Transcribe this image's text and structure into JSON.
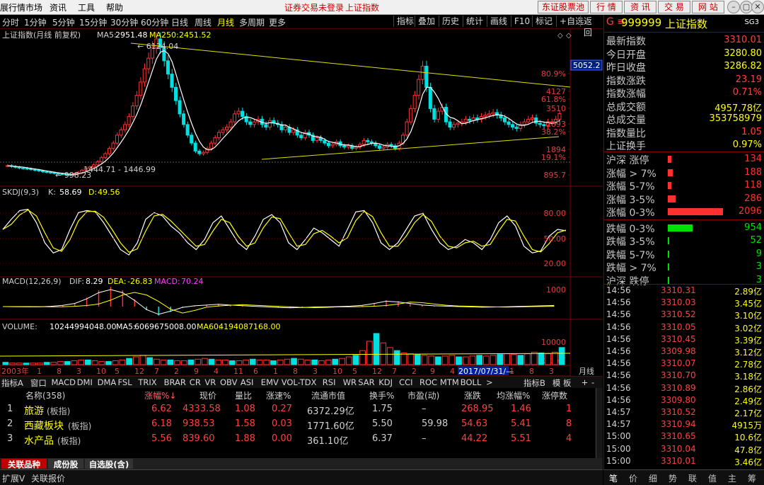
{
  "menu": {
    "items": [
      "展行情市场",
      "资讯",
      "工具",
      "帮助"
    ],
    "warning1": "证券交易未登录",
    "warning2": "上证指数",
    "right_buttons": [
      "东证股票池",
      "行 情",
      "资 讯",
      "交 易",
      "网 站"
    ]
  },
  "toolbar": {
    "periods": [
      "分时",
      "1分钟",
      "5分钟",
      "15分钟",
      "30分钟",
      "60分钟",
      "日线",
      "周线",
      "月线",
      "多周期",
      "更多"
    ],
    "active": "月线",
    "right": [
      "指标",
      "叠加",
      "历史",
      "统计",
      "画线",
      "F10",
      "标记",
      "自选",
      "返回"
    ]
  },
  "main": {
    "title": "上证指数(月线 前复权)",
    "ma5_label": "MA5:",
    "ma5": "2951.48",
    "ma250_label": "MA250:",
    "ma250": "2451.52",
    "high_label": "6124.04",
    "low_label": "998.23",
    "range_label": "1444.71 - 1446.99",
    "last_label": "5052.2"
  },
  "axes": {
    "price_ticks": [
      {
        "v": "80.9%",
        "c": "#e04040"
      },
      {
        "v": "4127",
        "c": "#e04040"
      },
      {
        "v": "61.8%",
        "c": "#e04040"
      },
      {
        "v": "3510",
        "c": "#e04040"
      },
      {
        "v": "2893",
        "c": "#e04040"
      },
      {
        "v": "38.2%",
        "c": "#e04040"
      },
      {
        "v": "1894",
        "c": "#e04040"
      },
      {
        "v": "19.1%",
        "c": "#e04040"
      },
      {
        "v": "895.7",
        "c": "#e04040"
      }
    ],
    "kdj_ticks": [
      "80.00",
      "50.00",
      "20.00"
    ],
    "macd_ticks": [
      "1000"
    ],
    "vol_ticks": [
      "10000",
      "X100万"
    ],
    "x_ticks": [
      "2003年",
      "1",
      "8",
      "3",
      "10",
      "5",
      "12",
      "7",
      "2",
      "9",
      "4",
      "11",
      "6",
      "1",
      "8",
      "3",
      "10",
      "5",
      "12",
      "7",
      "2",
      "9",
      "4",
      "2017/07/31/—",
      "1",
      "8",
      "3"
    ],
    "period_label": "月线"
  },
  "indicators": {
    "kdj_label": "SKDJ(9,3)",
    "k_label": "K:",
    "k": "58.69",
    "d_label": "D:",
    "d": "49.56",
    "macd_label": "MACD(12,26,9)",
    "dif_label": "DIF:",
    "dif": "8.29",
    "dea_label": "DEA:",
    "dea": "-26.83",
    "macd_v_label": "MACD:",
    "macd_v": "70.24",
    "vol_label": "VOLUME:",
    "vol": "10244994048.00",
    "vma5_label": "MA5:",
    "vma5": "6069675008.00",
    "vma60_label": "MA60:",
    "vma60": "4194087168.00"
  },
  "chart_data": {
    "type": "candlestick",
    "x_range": [
      "2003年",
      "2017"
    ],
    "ylim": [
      895.7,
      6124.04
    ],
    "overlays": {
      "ma5": 2951.48,
      "ma250": 2451.52
    },
    "price": [
      1350,
      1320,
      1290,
      1260,
      1250,
      1230,
      1200,
      1180,
      1150,
      1120,
      1100,
      1080,
      1060,
      1040,
      1030,
      1010,
      1000,
      1050,
      1100,
      1180,
      1250,
      1300,
      1380,
      1500,
      1650,
      1800,
      2000,
      2200,
      2500,
      2700,
      2900,
      3200,
      3600,
      4000,
      4500,
      5000,
      5400,
      5800,
      6124,
      5800,
      5300,
      4800,
      4300,
      3800,
      3300,
      2900,
      2500,
      2200,
      1900,
      1800,
      1850,
      2000,
      2200,
      2400,
      2600,
      2700,
      2800,
      3000,
      3300,
      3400,
      3200,
      3000,
      2900,
      3000,
      3100,
      2900,
      2800,
      3050,
      2950,
      2900,
      2700,
      2800,
      2600,
      2700,
      2500,
      2400,
      2600,
      2500,
      2300,
      2400,
      2300,
      2200,
      2100,
      2150,
      2250,
      2100,
      2050,
      2100,
      2000,
      2050,
      2150,
      2300,
      2250,
      2200,
      2100,
      2000,
      2050,
      2150,
      2100,
      2000,
      2200,
      2500,
      3000,
      3500,
      4000,
      4600,
      5100,
      4300,
      3500,
      3100,
      3400,
      3550,
      3000,
      2800,
      2900,
      2950,
      3000,
      3100,
      3050,
      3150,
      3100,
      3200,
      3250,
      3300,
      3350,
      3250,
      3150,
      3000,
      2900,
      2800,
      2750,
      2900,
      3000,
      3100,
      3150,
      2950,
      2900,
      2850,
      3000,
      3000,
      3100,
      3310
    ],
    "kdj": [
      60,
      75,
      88,
      90,
      70,
      40,
      25,
      30,
      60,
      85,
      88,
      86,
      70,
      50,
      30,
      22,
      40,
      75,
      85,
      80,
      65,
      55,
      40,
      30,
      45,
      70,
      80,
      60,
      40,
      30,
      50,
      75,
      82,
      70,
      40,
      30,
      45,
      62,
      55,
      45,
      35,
      60,
      86,
      88,
      70,
      40,
      30,
      40,
      60,
      80,
      84,
      60,
      40,
      30,
      35,
      45,
      40,
      30,
      45,
      70,
      80,
      65,
      35,
      25,
      28,
      50,
      60,
      58
    ],
    "macd": [
      0,
      -10,
      -20,
      -15,
      20,
      80,
      200,
      500,
      900,
      1100,
      900,
      400,
      -200,
      -500,
      -300,
      -50,
      50,
      100,
      150,
      100,
      60,
      20,
      -20,
      -60,
      -80,
      -60,
      -30,
      -20,
      0,
      30,
      80,
      200,
      350,
      300,
      200,
      100,
      50,
      30,
      0,
      -20,
      -40,
      -30,
      -10,
      10,
      30,
      50,
      70
    ],
    "volume": [
      3,
      2,
      2,
      2,
      2,
      2,
      3,
      3,
      4,
      4,
      5,
      6,
      6,
      5,
      4,
      4,
      5,
      6,
      8,
      10,
      12,
      9,
      7,
      6,
      6,
      5,
      5,
      6,
      7,
      8,
      7,
      6,
      6,
      5,
      5,
      6,
      7,
      6,
      6,
      5,
      6,
      7,
      8,
      7,
      6,
      6,
      5,
      6,
      7,
      8,
      10,
      12,
      18,
      30,
      40,
      28,
      22,
      18,
      15,
      14,
      13,
      12,
      11,
      10,
      11,
      12,
      10,
      10,
      11,
      12,
      11,
      12,
      13,
      14,
      13,
      12,
      14,
      16,
      15,
      14,
      16,
      22
    ]
  },
  "quote": {
    "code_prefix": "G ≡",
    "code": "999999",
    "name": "上证指数",
    "tag": "SG3",
    "rows": [
      {
        "label": "最新指数",
        "value": "3310.01",
        "color": "#ff4040"
      },
      {
        "label": "今日开盘",
        "value": "3280.80",
        "color": "#ffff00"
      },
      {
        "label": "昨日收盘",
        "value": "3286.82",
        "color": "#ffff00"
      },
      {
        "label": "指数涨跌",
        "value": "23.19",
        "color": "#ff4040"
      },
      {
        "label": "指数涨幅",
        "value": "0.71%",
        "color": "#ff4040"
      },
      {
        "label": "总成交额",
        "value": "4957.78亿",
        "color": "#ffff00"
      },
      {
        "label": "总成交量",
        "value": "353758979",
        "color": "#ffff00"
      },
      {
        "label": "指数量比",
        "value": "1.05",
        "color": "#ff4040"
      },
      {
        "label": "上证换手",
        "value": "0.97%",
        "color": "#ffff00"
      }
    ],
    "breadth": [
      {
        "label": "沪深 涨停",
        "value": "134",
        "color": "#ff3030",
        "bar": 0.06
      },
      {
        "label": "涨幅 > 7%",
        "value": "188",
        "color": "#ff3030",
        "bar": 0.09
      },
      {
        "label": "涨幅 5-7%",
        "value": "118",
        "color": "#ff3030",
        "bar": 0.06
      },
      {
        "label": "涨幅 3-5%",
        "value": "286",
        "color": "#ff3030",
        "bar": 0.14
      },
      {
        "label": "涨幅 0-3%",
        "value": "2096",
        "color": "#ff3030",
        "bar": 1.0
      },
      {
        "label": "跌幅 0-3%",
        "value": "954",
        "color": "#00e000",
        "bar": 0.45
      },
      {
        "label": "跌幅 3-5%",
        "value": "52",
        "color": "#00e000",
        "bar": 0.02
      },
      {
        "label": "跌幅 5-7%",
        "value": "9",
        "color": "#00e000",
        "bar": 0.005
      },
      {
        "label": "跌幅 > 7%",
        "value": "3",
        "color": "#00e000",
        "bar": 0.003
      },
      {
        "label": "沪深 跌停",
        "value": "3",
        "color": "#00e000",
        "bar": 0.003
      }
    ],
    "ticks": [
      {
        "t": "14:56",
        "p": "3310.31",
        "v": "2.89亿"
      },
      {
        "t": "14:56",
        "p": "3310.03",
        "v": "3.45亿"
      },
      {
        "t": "14:56",
        "p": "3310.52",
        "v": "3.10亿"
      },
      {
        "t": "14:56",
        "p": "3310.05",
        "v": "3.02亿"
      },
      {
        "t": "14:56",
        "p": "3310.45",
        "v": "3.39亿"
      },
      {
        "t": "14:56",
        "p": "3309.98",
        "v": "3.12亿"
      },
      {
        "t": "14:56",
        "p": "3310.07",
        "v": "2.78亿"
      },
      {
        "t": "14:56",
        "p": "3310.70",
        "v": "3.18亿"
      },
      {
        "t": "14:56",
        "p": "3310.89",
        "v": "2.86亿"
      },
      {
        "t": "14:56",
        "p": "3309.80",
        "v": "2.49亿"
      },
      {
        "t": "14:57",
        "p": "3310.52",
        "v": "2.17亿"
      },
      {
        "t": "14:57",
        "p": "3310.94",
        "v": "4915万"
      },
      {
        "t": "15:00",
        "p": "3310.65",
        "v": "10.6亿"
      },
      {
        "t": "15:00",
        "p": "3310.04",
        "v": "47.8亿"
      },
      {
        "t": "15:00",
        "p": "3310.01",
        "v": "3.46亿"
      }
    ],
    "bottom_tabs": [
      "笔",
      "价",
      "细",
      "势",
      "联",
      "值",
      "主",
      "筹"
    ]
  },
  "indicator_tabs": [
    "指标A",
    "窗口",
    "MACD",
    "DMI",
    "DMA",
    "FSL",
    "TRIX",
    "BRAR",
    "CR",
    "VR",
    "OBV",
    "ASI",
    "EMV",
    "VOL-TDX",
    "RSI",
    "WR",
    "SAR",
    "KDJ",
    "CCI",
    "ROC",
    "MTM",
    "BOLL",
    ">",
    "指标B",
    "模 板",
    "+",
    "-"
  ],
  "table": {
    "headers": [
      "名称(358)",
      "涨幅%↓",
      "现价",
      "量比",
      "涨速%",
      "流通市值",
      "换手%",
      "市盈(动)",
      "涨跌",
      "均涨幅%",
      "涨停数"
    ],
    "rows": [
      {
        "idx": "1",
        "name": "旅游",
        "sub": "(板指)",
        "chg": "6.62",
        "price": "4333.58",
        "vr": "1.08",
        "spd": "0.27",
        "mcap": "6372.29亿",
        "to": "1.75",
        "pe": "–",
        "diff": "268.95",
        "avg": "1.46",
        "lim": "1"
      },
      {
        "idx": "2",
        "name": "西藏板块",
        "sub": "(板指)",
        "chg": "6.18",
        "price": "938.53",
        "vr": "1.58",
        "spd": "0.03",
        "mcap": "1771.60亿",
        "to": "5.50",
        "pe": "59.98",
        "diff": "54.63",
        "avg": "5.41",
        "lim": "8"
      },
      {
        "idx": "3",
        "name": "水产品",
        "sub": "(板指)",
        "chg": "5.56",
        "price": "839.60",
        "vr": "1.88",
        "spd": "0.00",
        "mcap": "361.10亿",
        "to": "6.37",
        "pe": "–",
        "diff": "44.22",
        "avg": "5.51",
        "lim": "4"
      }
    ]
  },
  "bottom_tabs": [
    "关联品种",
    "成份股",
    "自选股(含)"
  ],
  "status": [
    "扩展V",
    "关联报价"
  ]
}
